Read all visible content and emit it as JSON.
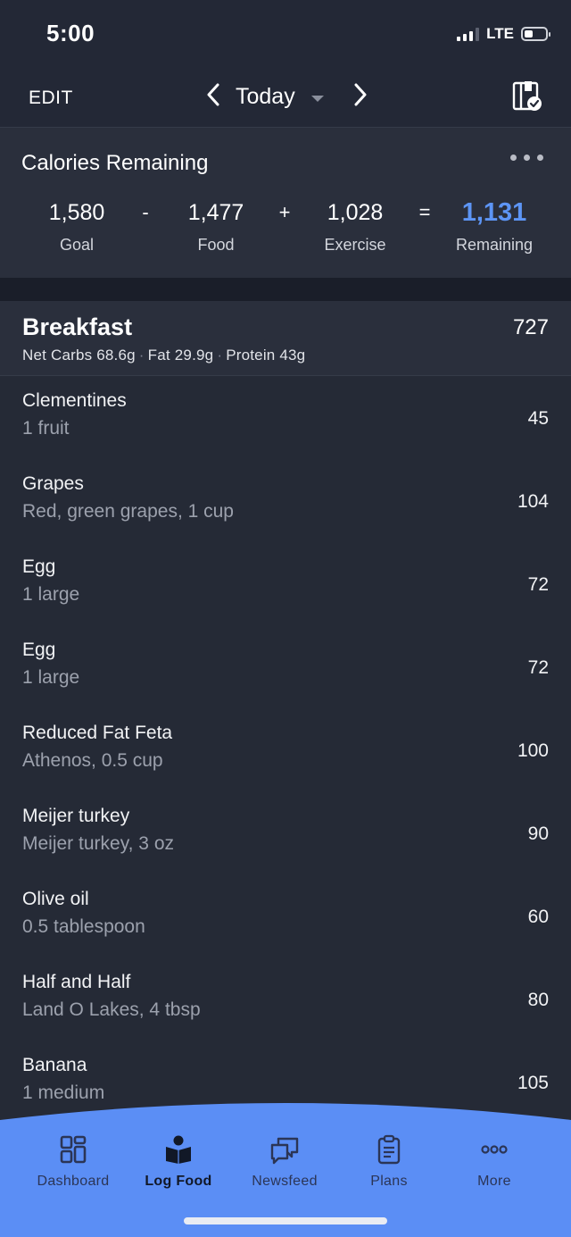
{
  "status": {
    "time": "5:00",
    "network": "LTE"
  },
  "nav": {
    "edit_label": "EDIT",
    "date_label": "Today"
  },
  "calories": {
    "title": "Calories Remaining",
    "goal": {
      "value": "1,580",
      "label": "Goal"
    },
    "food": {
      "value": "1,477",
      "label": "Food"
    },
    "exercise": {
      "value": "1,028",
      "label": "Exercise"
    },
    "remaining": {
      "value": "1,131",
      "label": "Remaining"
    },
    "ops": {
      "minus": "-",
      "plus": "+",
      "equals": "="
    }
  },
  "meal": {
    "name": "Breakfast",
    "calories": "727",
    "macros": {
      "carbs": "Net Carbs 68.6g",
      "fat": "Fat 29.9g",
      "protein": "Protein 43g",
      "separator": "·"
    },
    "items": [
      {
        "name": "Clementines",
        "desc": "1 fruit",
        "cal": "45"
      },
      {
        "name": "Grapes",
        "desc": "Red, green grapes, 1 cup",
        "cal": "104"
      },
      {
        "name": "Egg",
        "desc": "1 large",
        "cal": "72"
      },
      {
        "name": "Egg",
        "desc": "1 large",
        "cal": "72"
      },
      {
        "name": "Reduced Fat Feta",
        "desc": "Athenos, 0.5 cup",
        "cal": "100"
      },
      {
        "name": "Meijer turkey",
        "desc": "Meijer turkey, 3 oz",
        "cal": "90"
      },
      {
        "name": "Olive oil",
        "desc": "0.5 tablespoon",
        "cal": "60"
      },
      {
        "name": "Half and Half",
        "desc": "Land O Lakes, 4 tbsp",
        "cal": "80"
      },
      {
        "name": "Banana",
        "desc": "1 medium",
        "cal": "105"
      }
    ]
  },
  "tabs": [
    {
      "label": "Dashboard",
      "icon": "dashboard-icon"
    },
    {
      "label": "Log Food",
      "icon": "log-food-icon",
      "active": true
    },
    {
      "label": "Newsfeed",
      "icon": "newsfeed-icon"
    },
    {
      "label": "Plans",
      "icon": "plans-icon"
    },
    {
      "label": "More",
      "icon": "more-icon"
    }
  ],
  "colors": {
    "accent": "#5d95f5",
    "tab_bar": "#5b8ef5",
    "background": "#252a36"
  }
}
